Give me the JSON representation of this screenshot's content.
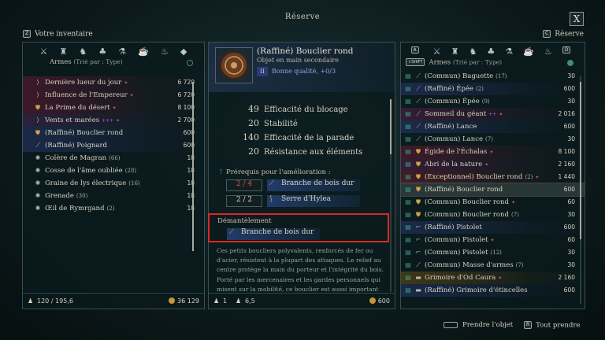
{
  "title": "Réserve",
  "close": "X",
  "left_header": {
    "key": "Z",
    "label": "Votre inventaire"
  },
  "right_header": {
    "key": "C",
    "label": "Réserve"
  },
  "left": {
    "sort_label": "Armes",
    "sort_sub": "(Trié par : Type)",
    "items": [
      {
        "name": "Dernière lueur du jour",
        "value": "6 720",
        "quality": "leg",
        "icon": "bow-icon",
        "flag": true
      },
      {
        "name": "Influence de l'Empereur",
        "value": "6 720",
        "quality": "leg",
        "icon": "bow-icon",
        "flag": true
      },
      {
        "name": "La Prime du désert",
        "value": "8 100",
        "quality": "leg",
        "icon": "shield-icon",
        "flag": true
      },
      {
        "name": "Vents et marées",
        "value": "2 700",
        "quality": "rare",
        "icon": "bow-icon",
        "flag": true,
        "extra": "+++"
      },
      {
        "name": "(Raffiné) Bouclier rond",
        "value": "600",
        "quality": "fine",
        "icon": "shield-icon"
      },
      {
        "name": "(Raffiné) Poignard",
        "value": "600",
        "quality": "fine",
        "icon": "dagger-icon"
      },
      {
        "name": "Colère de Magran",
        "count": "(66)",
        "value": "18",
        "icon": "rune-icon"
      },
      {
        "name": "Cosse de l'âme oubliée",
        "count": "(28)",
        "value": "18",
        "icon": "rune-icon"
      },
      {
        "name": "Graine de lys électrique",
        "count": "(16)",
        "value": "18",
        "icon": "rune-icon"
      },
      {
        "name": "Grenade",
        "count": "(30)",
        "value": "18",
        "icon": "rune-icon"
      },
      {
        "name": "Œil de Rymrgand",
        "count": "(2)",
        "value": "18",
        "icon": "rune-icon"
      }
    ],
    "footer": {
      "weight": "120 / 195,6",
      "gold": "36 129"
    }
  },
  "mid": {
    "title": "(Raffiné) Bouclier rond",
    "subtitle": "Objet en main secondaire",
    "badge": "II",
    "quality": "Bonne qualité, +0/3",
    "stats": [
      {
        "value": "49",
        "label": "Efficacité du blocage"
      },
      {
        "value": "20",
        "label": "Stabilité"
      },
      {
        "value": "140",
        "label": "Efficacité de la parade"
      },
      {
        "value": "20",
        "label": "Résistance aux éléments"
      }
    ],
    "prereq_title": "Prérequis pour l'amélioration :",
    "prereqs": [
      {
        "count": "2 / 4",
        "item": "Branche de bois dur",
        "short": true
      },
      {
        "count": "2 / 2",
        "item": "Serre d'Hylea",
        "short": false
      }
    ],
    "dismantle_title": "Démantèlement",
    "dismantle_item": "Branche de bois dur",
    "description": "Ces petits boucliers polyvalents, renforcés de fer ou d'acier, résistent à la plupart des attaques. Le relief au centre protège la main du porteur et l'intégrité du bois. Porté par les mercenaires et les gardes personnels qui misent sur la mobilité, ce bouclier est aussi important",
    "footer": {
      "count": "1",
      "weight": "6,5",
      "gold": "600"
    }
  },
  "right": {
    "key_a": "A",
    "key_d": "D",
    "shift": "⇧SHIFT",
    "sort_label": "Armes",
    "sort_sub": "(Trié par : Type)",
    "items": [
      {
        "name": "(Commun) Baguette",
        "count": "(17)",
        "value": "30",
        "icon": "wand-icon"
      },
      {
        "name": "(Raffiné) Épée",
        "count": "(2)",
        "value": "600",
        "quality": "fine",
        "icon": "sword-icon"
      },
      {
        "name": "(Commun) Épée",
        "count": "(9)",
        "value": "30",
        "icon": "sword-icon"
      },
      {
        "name": "Sommeil du géant",
        "value": "2 016",
        "quality": "epic",
        "icon": "sword-icon",
        "flag": true,
        "extra": "++"
      },
      {
        "name": "(Raffiné) Lance",
        "value": "600",
        "quality": "fine",
        "icon": "spear-icon"
      },
      {
        "name": "(Commun) Lance",
        "count": "(7)",
        "value": "30",
        "icon": "spear-icon"
      },
      {
        "name": "Égide de l'Échalas",
        "value": "8 100",
        "quality": "leg",
        "icon": "shield-icon",
        "flag": true
      },
      {
        "name": "Abri de la nature",
        "value": "2 160",
        "quality": "epic",
        "icon": "shield-icon",
        "flag": true
      },
      {
        "name": "(Exceptionnel) Bouclier rond",
        "count": "(2)",
        "value": "1 440",
        "quality": "exc",
        "icon": "shield-icon",
        "flag": true
      },
      {
        "name": "(Raffiné) Bouclier rond",
        "value": "600",
        "quality": "fine",
        "icon": "shield-icon",
        "selected": true
      },
      {
        "name": "(Commun) Bouclier rond",
        "value": "60",
        "icon": "shield-icon",
        "flag": true
      },
      {
        "name": "(Commun) Bouclier rond",
        "count": "(7)",
        "value": "30",
        "icon": "shield-icon"
      },
      {
        "name": "(Raffiné) Pistolet",
        "value": "600",
        "quality": "fine",
        "icon": "gun-icon"
      },
      {
        "name": "(Commun) Pistolet",
        "value": "60",
        "icon": "gun-icon",
        "flag": true
      },
      {
        "name": "(Commun) Pistolet",
        "count": "(12)",
        "value": "30",
        "icon": "gun-icon"
      },
      {
        "name": "(Commun) Masse d'armes",
        "count": "(7)",
        "value": "30",
        "icon": "mace-icon"
      },
      {
        "name": "Grimoire d'Od Caura",
        "value": "2 160",
        "quality": "gold",
        "icon": "book-icon",
        "flag": true
      },
      {
        "name": "(Raffiné) Grimoire d'étincelles",
        "value": "600",
        "quality": "fine",
        "icon": "book-icon"
      }
    ]
  },
  "bottom": {
    "take_label": "Prendre l'objet",
    "take_all_key": "R",
    "take_all_label": "Tout prendre"
  },
  "colors": {
    "accent": "#3e8c7c",
    "gold": "#c9962f",
    "highlight": "#d42a2a"
  }
}
